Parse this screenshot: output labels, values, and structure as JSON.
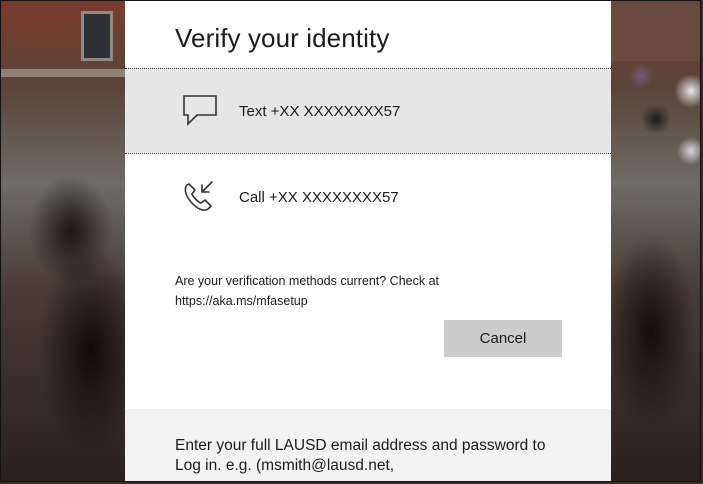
{
  "dialog": {
    "title": "Verify your identity",
    "options": [
      {
        "label": "Text +XX XXXXXXXX57",
        "icon": "chat-bubble-icon"
      },
      {
        "label": "Call +XX XXXXXXXX57",
        "icon": "phone-call-icon"
      }
    ],
    "info_line1": "Are your verification methods current? Check at",
    "info_line2": "https://aka.ms/mfasetup",
    "cancel_label": "Cancel"
  },
  "footer": {
    "line1": "Enter your full LAUSD email address and password to",
    "line2": "Log in. e.g. (msmith@lausd.net,"
  }
}
